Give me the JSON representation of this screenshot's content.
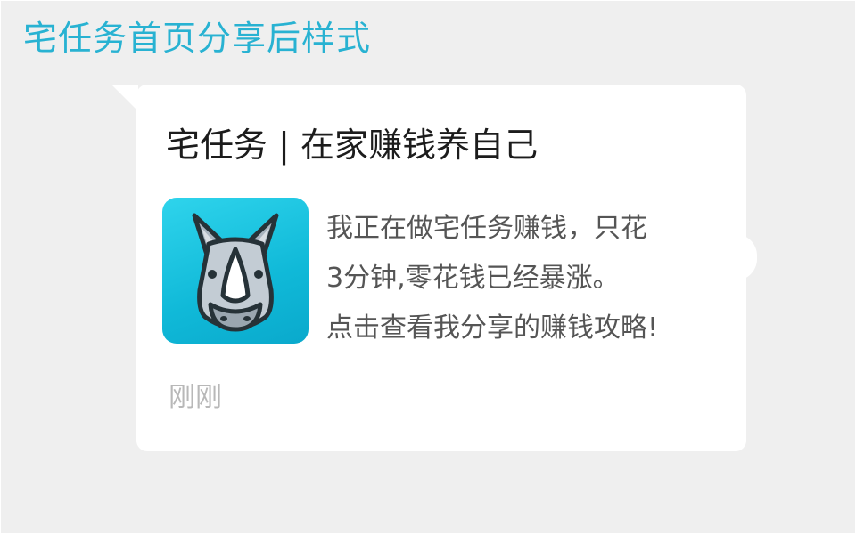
{
  "page": {
    "title": "宅任务首页分享后样式"
  },
  "share_card": {
    "title": "宅任务 | 在家赚钱养自己",
    "icon": "rhino-app-icon",
    "description_lines": [
      "我正在做宅任务赚钱，只花",
      "3分钟,零花钱已经暴涨。",
      "点击查看我分享的赚钱攻略!"
    ],
    "timestamp": "刚刚"
  },
  "colors": {
    "title_accent": "#28b2d2",
    "background": "#efefef",
    "card": "#ffffff",
    "icon_background": "#14bcdc",
    "text_primary": "#1c1c1c",
    "text_secondary": "#555555",
    "text_muted": "#b8b8b8"
  }
}
